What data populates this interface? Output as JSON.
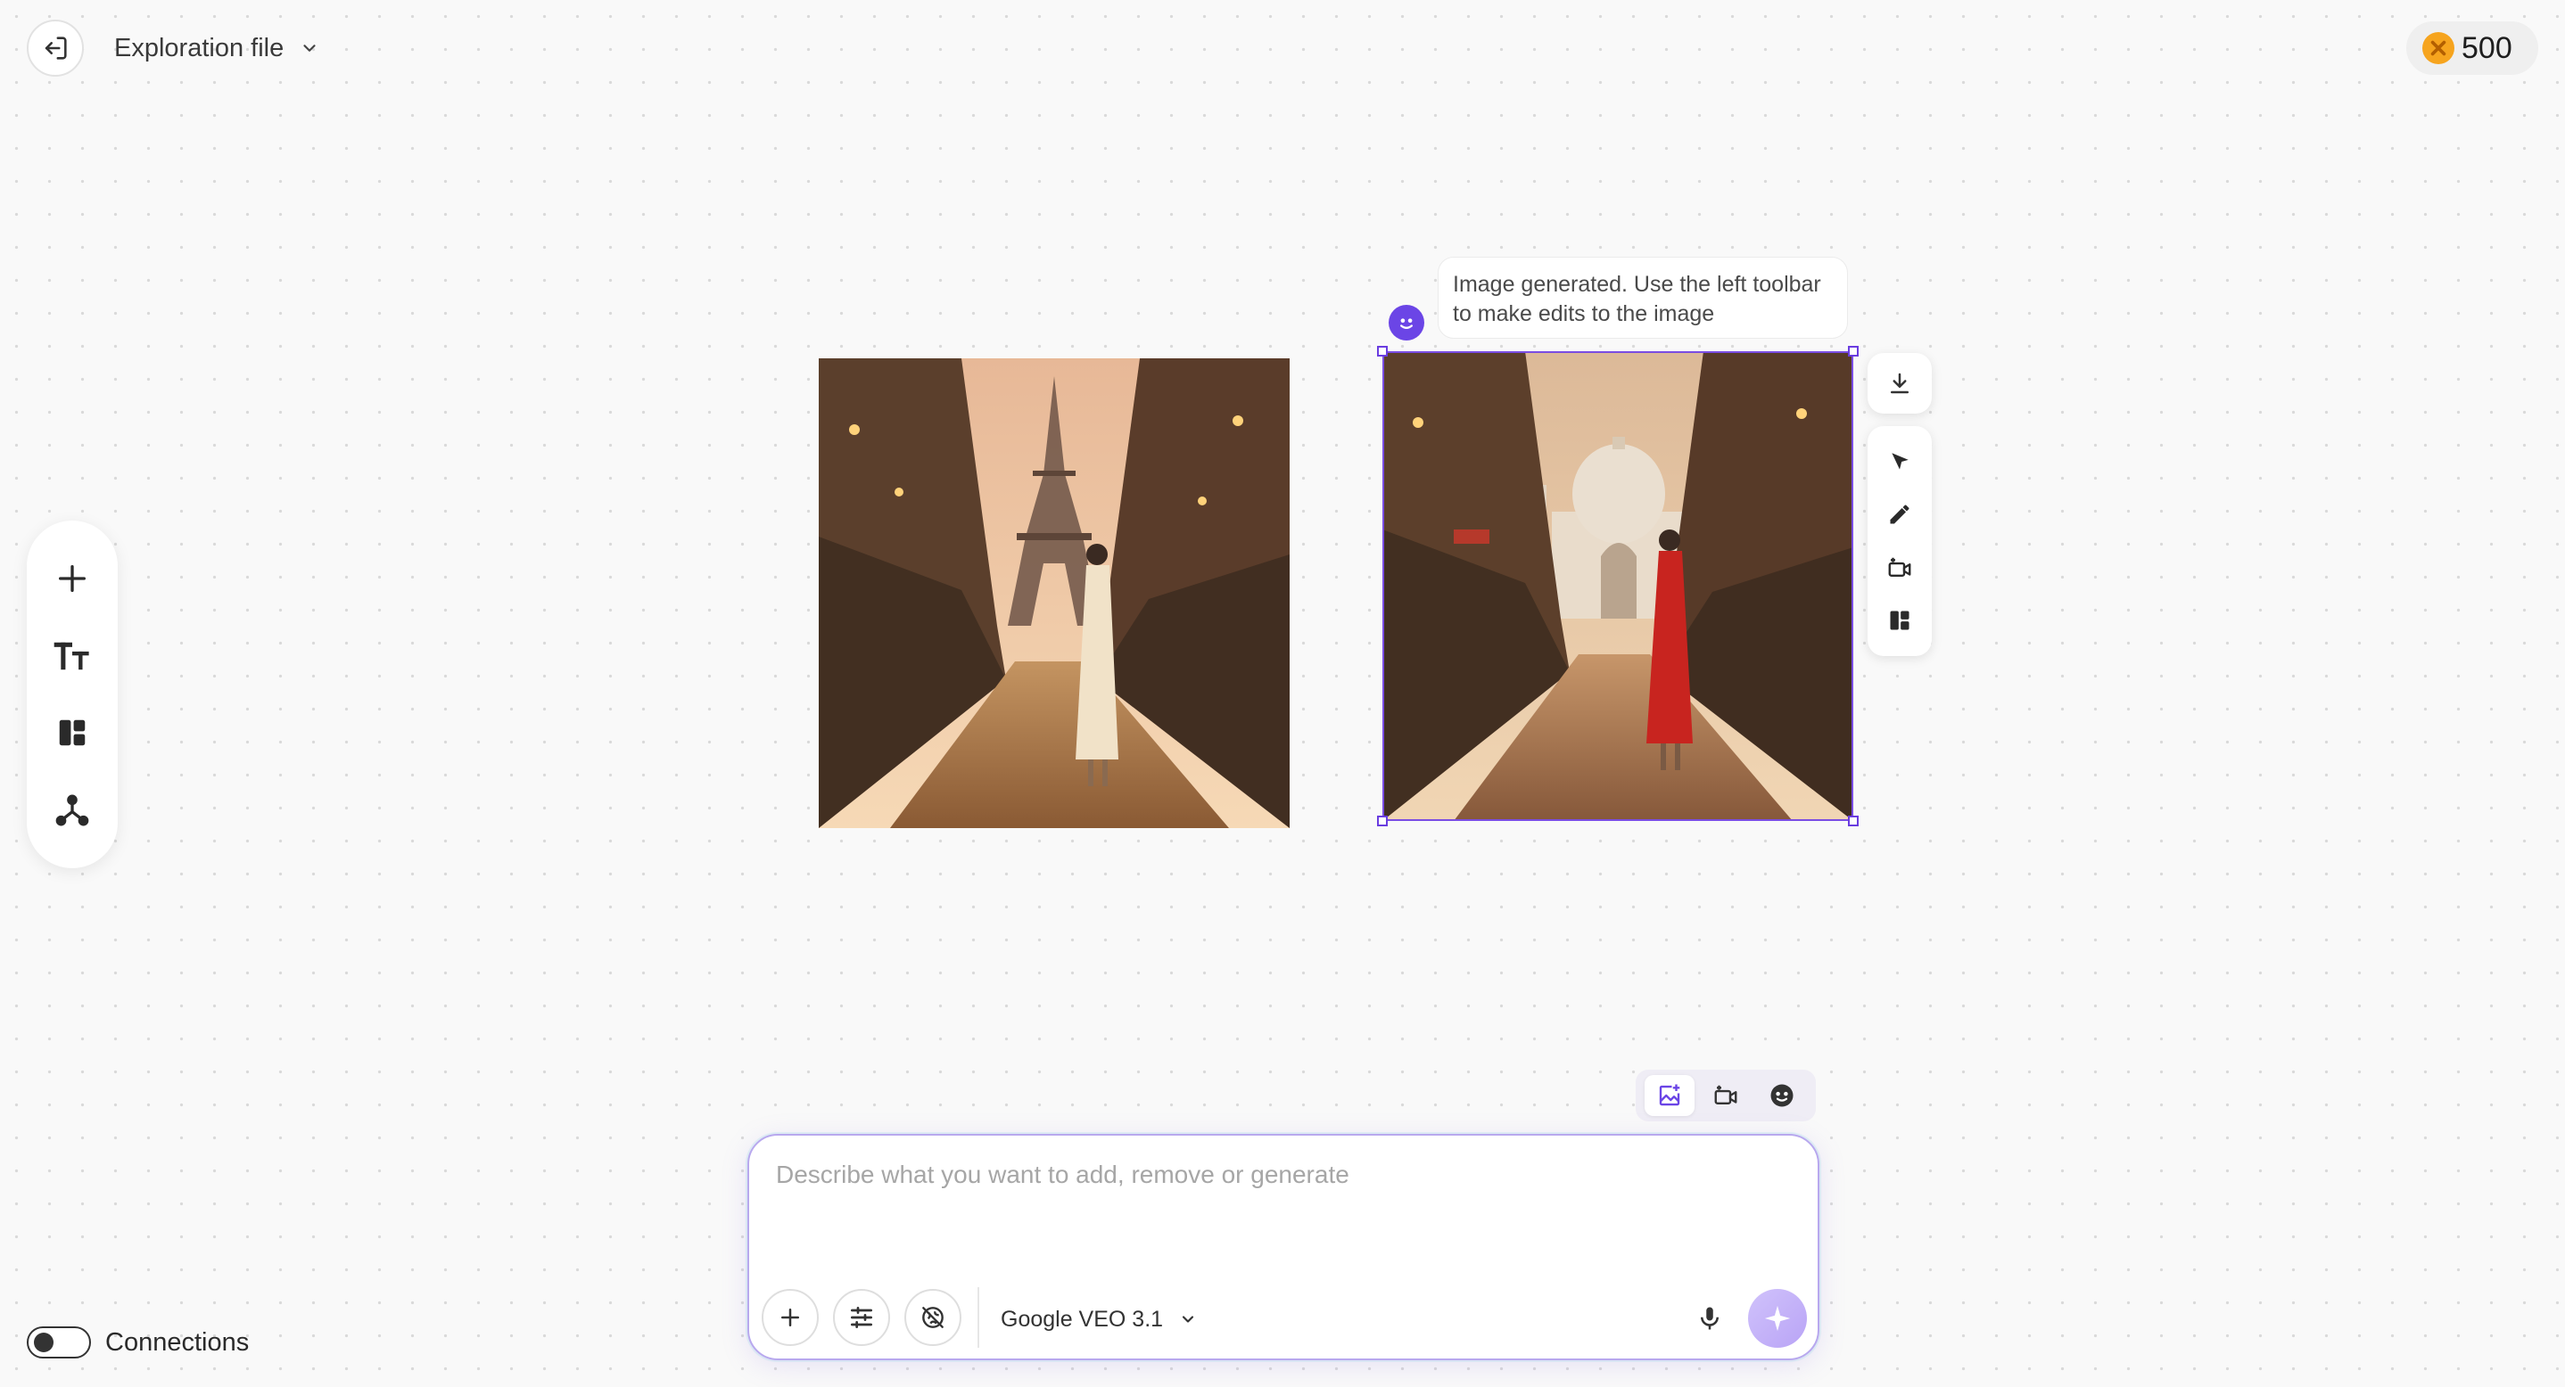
{
  "header": {
    "back_icon": "exit-icon",
    "file_name": "Exploration file",
    "credits": "500",
    "colors": {
      "coin": "#f6a41e"
    }
  },
  "left_toolbar": {
    "tools": [
      "plus-icon",
      "text-icon",
      "layout-icon",
      "connections-icon"
    ]
  },
  "canvas": {
    "images": [
      {
        "subject": "Woman in white dress walking on cobblestone Paris street toward Eiffel Tower at sunset"
      },
      {
        "subject": "Woman in red dress walking on cobblestone street toward Taj Mahal at sunset",
        "selected": true
      }
    ],
    "tooltip": {
      "line1": "Image generated. Use the left toolbar",
      "line2": "to make edits to the image"
    },
    "image_actions": [
      "download-icon",
      "select-arrow-icon",
      "pencil-icon",
      "video-edit-icon",
      "layout-icon"
    ]
  },
  "mode_switch": {
    "modes": [
      "image-mode-icon",
      "video-mode-icon",
      "ai-assistant-icon"
    ],
    "active": 0
  },
  "prompt": {
    "placeholder": "Describe what you want to add, remove or generate",
    "value": "",
    "model": "Google VEO 3.1",
    "accent": "#b8a8ee"
  },
  "footer": {
    "connections_label": "Connections",
    "connections_on": false
  }
}
